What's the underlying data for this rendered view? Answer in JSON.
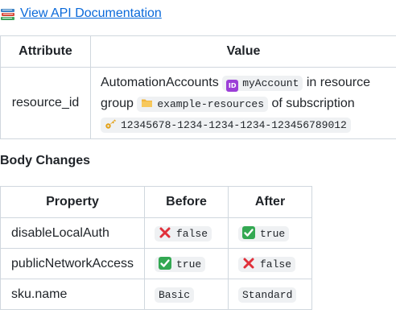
{
  "doc_link": {
    "label": "View API Documentation"
  },
  "attribute_table": {
    "headers": {
      "attribute": "Attribute",
      "value": "Value"
    },
    "row": {
      "key": "resource_id",
      "text_1": "AutomationAccounts",
      "account_icon_label": "ID",
      "account_name": "myAccount",
      "text_2": "in resource group",
      "resource_group": "example-resources",
      "text_3": "of subscription",
      "subscription_id": "12345678-1234-1234-1234-123456789012"
    }
  },
  "section_title": "Body Changes",
  "body_table": {
    "headers": {
      "property": "Property",
      "before": "Before",
      "after": "After"
    },
    "rows": [
      {
        "property": "disableLocalAuth",
        "before": "false",
        "before_icon": "cross-mark",
        "after": "true",
        "after_icon": "check-mark"
      },
      {
        "property": "publicNetworkAccess",
        "before": "true",
        "before_icon": "check-mark",
        "after": "false",
        "after_icon": "cross-mark"
      },
      {
        "property": "sku.name",
        "before": "Basic",
        "after": "Standard"
      }
    ]
  },
  "colors": {
    "link": "#0969da",
    "border": "#d0d7de",
    "code_bg": "#eff1f3",
    "cross": "#e0303a",
    "check": "#33a852",
    "id_badge": "#9c3fd7"
  }
}
